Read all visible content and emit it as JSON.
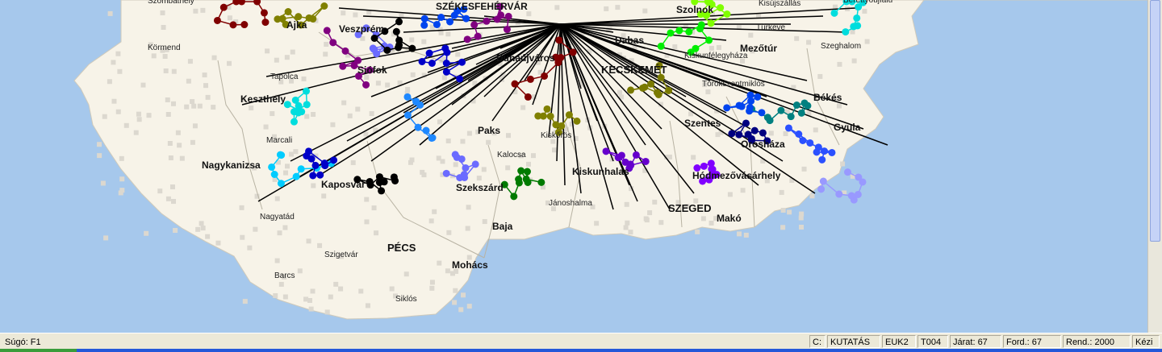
{
  "map": {
    "cities": [
      {
        "id": "szombathely",
        "label": "Szombathely",
        "kind": "town"
      },
      {
        "id": "ajka",
        "label": "Ajka",
        "kind": "city"
      },
      {
        "id": "veszprem",
        "label": "Veszprém",
        "kind": "city"
      },
      {
        "id": "kormend",
        "label": "Körmend",
        "kind": "town"
      },
      {
        "id": "tapolca",
        "label": "Tapolca",
        "kind": "town"
      },
      {
        "id": "siofok",
        "label": "Siófok",
        "kind": "city"
      },
      {
        "id": "keszthely",
        "label": "Keszthely",
        "kind": "city"
      },
      {
        "id": "marcali",
        "label": "Marcali",
        "kind": "town"
      },
      {
        "id": "nagykanizsa",
        "label": "Nagykanizsa",
        "kind": "city"
      },
      {
        "id": "kaposvar",
        "label": "Kaposvár",
        "kind": "city"
      },
      {
        "id": "nagyatad",
        "label": "Nagyatád",
        "kind": "town"
      },
      {
        "id": "szigetvar",
        "label": "Szigetvár",
        "kind": "town"
      },
      {
        "id": "pecs",
        "label": "PÉCS",
        "kind": "bigcity"
      },
      {
        "id": "barcs",
        "label": "Barcs",
        "kind": "town"
      },
      {
        "id": "mohacs",
        "label": "Mohács",
        "kind": "city"
      },
      {
        "id": "siklos",
        "label": "Siklós",
        "kind": "town"
      },
      {
        "id": "paks",
        "label": "Paks",
        "kind": "city"
      },
      {
        "id": "kalocsa",
        "label": "Kalocsa",
        "kind": "town"
      },
      {
        "id": "szekszard",
        "label": "Szekszárd",
        "kind": "city"
      },
      {
        "id": "baja",
        "label": "Baja",
        "kind": "city"
      },
      {
        "id": "janoshalma",
        "label": "Jánoshalma",
        "kind": "town"
      },
      {
        "id": "kiskunhalas",
        "label": "Kiskunhalas",
        "kind": "city"
      },
      {
        "id": "szeged",
        "label": "SZEGED",
        "kind": "bigcity"
      },
      {
        "id": "mako",
        "label": "Makó",
        "kind": "city"
      },
      {
        "id": "hodmezovasarhely",
        "label": "Hódmezővásárhely",
        "kind": "city"
      },
      {
        "id": "oroshaza",
        "label": "Orosháza",
        "kind": "city"
      },
      {
        "id": "szentes",
        "label": "Szentes",
        "kind": "city"
      },
      {
        "id": "bekes",
        "label": "Békés",
        "kind": "city"
      },
      {
        "id": "gyula",
        "label": "Gyula",
        "kind": "city"
      },
      {
        "id": "mezotur",
        "label": "Mezőtúr",
        "kind": "city"
      },
      {
        "id": "turkeve",
        "label": "Túrkeve",
        "kind": "town"
      },
      {
        "id": "szeghalom",
        "label": "Szeghalom",
        "kind": "town"
      },
      {
        "id": "kisujszallas",
        "label": "Kisújszállás",
        "kind": "town"
      },
      {
        "id": "berettyoujfalu",
        "label": "Berettyóújfalu",
        "kind": "town"
      },
      {
        "id": "szolnok",
        "label": "Szolnok",
        "kind": "city"
      },
      {
        "id": "dabas",
        "label": "Dabas",
        "kind": "city"
      },
      {
        "id": "kecskemet",
        "label": "KECSKEMÉT",
        "kind": "bigcity"
      },
      {
        "id": "dunaujvaros",
        "label": "Dunaújváros",
        "kind": "city"
      },
      {
        "id": "kiskoros",
        "label": "Kiskőrös",
        "kind": "town"
      },
      {
        "id": "kiskunfelegyhaza",
        "label": "Kiskunfélegyháza",
        "kind": "town"
      },
      {
        "id": "torokszentmiklos",
        "label": "Törökszentmiklós",
        "kind": "town"
      },
      {
        "id": "szekesfehervar",
        "label": "SZÉKESFEHÉRVÁR",
        "kind": "city"
      }
    ],
    "colors": {
      "sea": "#a6c8ec",
      "land": "#f7f3e8",
      "hub_lines": "#000000",
      "route_colors": [
        "#800000",
        "#808000",
        "#6b6bff",
        "#000000",
        "#0000c8",
        "#0044ee",
        "#00dddd",
        "#800080",
        "#00ccff",
        "#1e88ff",
        "#007a00",
        "#00ee00",
        "#6600cc",
        "#7a7a00",
        "#008080",
        "#000080",
        "#2b50ff",
        "#80ff00",
        "#8000ff",
        "#9999ff"
      ]
    },
    "hub_label": "hub"
  },
  "status": {
    "help": "Súgó: F1",
    "drive": "C:",
    "mode": "KUTATÁS",
    "code1": "EUK2",
    "code2": "T004",
    "jarat": "Járat:  67",
    "ford": "Ford.:  67",
    "rend": "Rend.: 2000",
    "kezi": "Kézi"
  }
}
